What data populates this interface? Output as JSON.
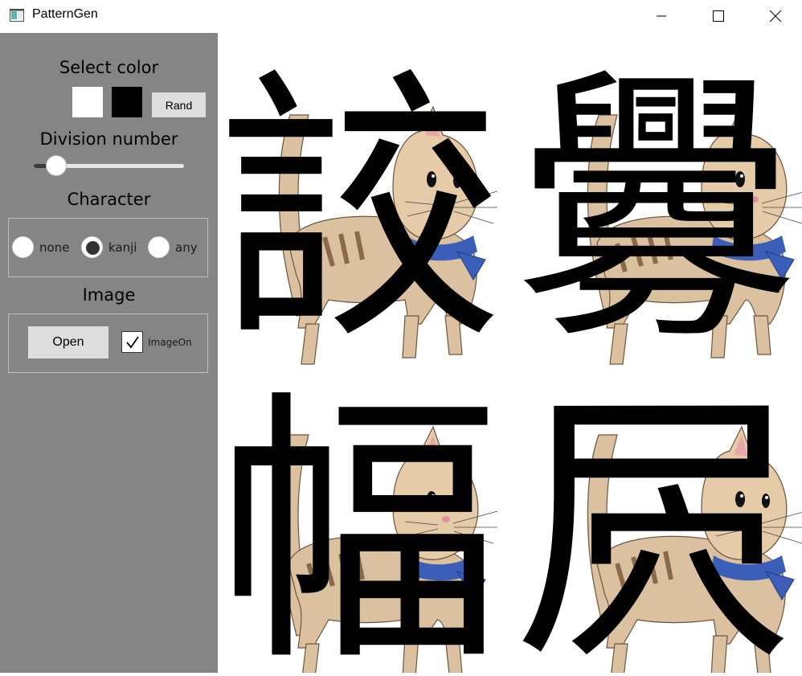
{
  "window": {
    "title": "PatternGen"
  },
  "sidebar": {
    "select_color_label": "Select color",
    "colors": [
      "#ffffff",
      "#000000"
    ],
    "rand_label": "Rand",
    "division_label": "Division number",
    "division_slider_value": 0.15,
    "character_label": "Character",
    "character_options": [
      "none",
      "kanji",
      "any"
    ],
    "character_selected": "kanji",
    "image_label": "Image",
    "open_label": "Open",
    "image_on_label": "ImageOn",
    "image_on_checked": true
  },
  "pattern": {
    "characters": [
      "詨",
      "釁",
      "幅",
      "屄"
    ],
    "foreground": "#000000",
    "background_image": "cat-illustration"
  }
}
